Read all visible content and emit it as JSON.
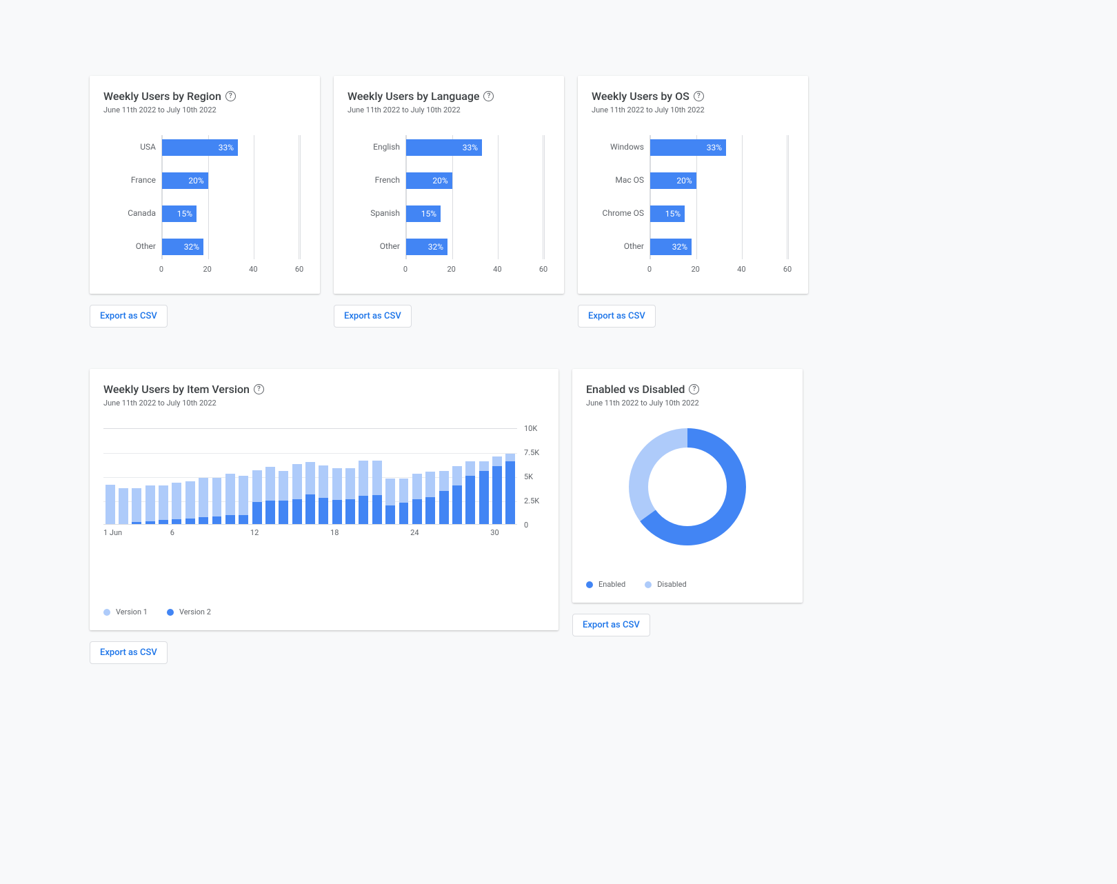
{
  "date_range": "June 11th 2022 to July 10th 2022",
  "export_label": "Export as CSV",
  "region_card": {
    "title": "Weekly Users by Region"
  },
  "language_card": {
    "title": "Weekly Users by Language"
  },
  "os_card": {
    "title": "Weekly Users by OS"
  },
  "version_card": {
    "title": "Weekly Users by Item Version"
  },
  "enabled_card": {
    "title": "Enabled vs Disabled"
  },
  "legend": {
    "version1": "Version 1",
    "version2": "Version 2",
    "enabled": "Enabled",
    "disabled": "Disabled"
  },
  "colors": {
    "primary": "#4285f4",
    "light": "#aecbfa"
  },
  "chart_data": [
    {
      "id": "region",
      "type": "bar",
      "orientation": "horizontal",
      "title": "Weekly Users by Region",
      "categories": [
        "USA",
        "France",
        "Canada",
        "Other"
      ],
      "values": [
        33,
        20,
        15,
        32
      ],
      "value_labels": [
        "33%",
        "20%",
        "15%",
        "32%"
      ],
      "xlim": [
        0,
        60
      ],
      "xticks": [
        0,
        20,
        40,
        60
      ]
    },
    {
      "id": "language",
      "type": "bar",
      "orientation": "horizontal",
      "title": "Weekly Users by Language",
      "categories": [
        "English",
        "French",
        "Spanish",
        "Other"
      ],
      "values": [
        33,
        20,
        15,
        32
      ],
      "value_labels": [
        "33%",
        "20%",
        "15%",
        "32%"
      ],
      "xlim": [
        0,
        60
      ],
      "xticks": [
        0,
        20,
        40,
        60
      ]
    },
    {
      "id": "os",
      "type": "bar",
      "orientation": "horizontal",
      "title": "Weekly Users by OS",
      "categories": [
        "Windows",
        "Mac OS",
        "Chrome OS",
        "Other"
      ],
      "values": [
        33,
        20,
        15,
        32
      ],
      "value_labels": [
        "33%",
        "20%",
        "15%",
        "32%"
      ],
      "xlim": [
        0,
        60
      ],
      "xticks": [
        0,
        20,
        40,
        60
      ]
    },
    {
      "id": "version",
      "type": "bar",
      "stacked": true,
      "title": "Weekly Users by Item Version",
      "x": [
        1,
        2,
        3,
        4,
        5,
        6,
        7,
        8,
        9,
        10,
        11,
        12,
        13,
        14,
        15,
        16,
        17,
        18,
        19,
        20,
        21,
        22,
        23,
        24,
        25,
        26,
        27,
        28,
        29,
        30,
        31
      ],
      "xticks": [
        "1 Jun",
        "6",
        "12",
        "18",
        "24",
        "30"
      ],
      "yticks": [
        0,
        2500,
        5000,
        7500,
        10000
      ],
      "ytick_labels": [
        "0",
        "2.5K",
        "5K",
        "7.5K",
        "10K"
      ],
      "ylim": [
        0,
        10000
      ],
      "series": [
        {
          "name": "Version 1",
          "color": "#aecbfa",
          "values": [
            4100,
            3700,
            3500,
            3700,
            3600,
            3800,
            3800,
            4100,
            4000,
            4300,
            4100,
            3300,
            3500,
            3100,
            3600,
            3300,
            3400,
            3300,
            3200,
            3700,
            3600,
            2800,
            2500,
            2600,
            2600,
            2100,
            2000,
            1500,
            1000,
            1000,
            800
          ]
        },
        {
          "name": "Version 2",
          "color": "#4285f4",
          "values": [
            0,
            0,
            200,
            300,
            400,
            500,
            600,
            700,
            800,
            900,
            900,
            2300,
            2400,
            2400,
            2600,
            3100,
            2700,
            2500,
            2600,
            2900,
            3000,
            1900,
            2200,
            2600,
            2800,
            3400,
            4000,
            5000,
            5500,
            6000,
            6500
          ]
        }
      ]
    },
    {
      "id": "enabled",
      "type": "pie",
      "donut": true,
      "title": "Enabled vs Disabled",
      "categories": [
        "Enabled",
        "Disabled"
      ],
      "values": [
        65,
        35
      ],
      "colors": [
        "#4285f4",
        "#aecbfa"
      ]
    }
  ]
}
